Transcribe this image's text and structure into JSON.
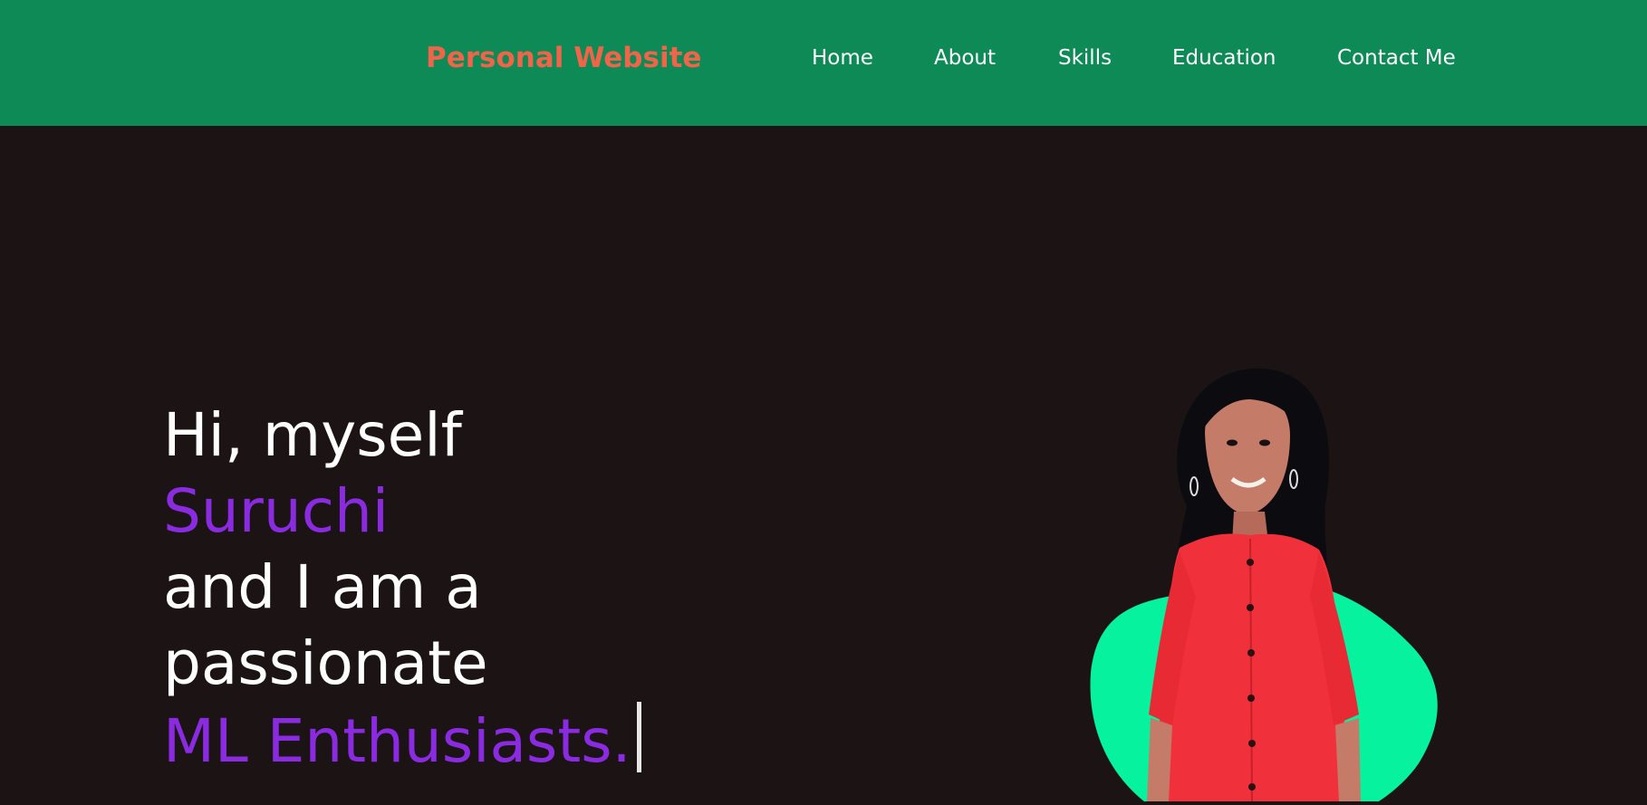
{
  "header": {
    "brand": "Personal Website",
    "nav": [
      {
        "label": "Home"
      },
      {
        "label": "About"
      },
      {
        "label": "Skills"
      },
      {
        "label": "Education"
      },
      {
        "label": "Contact Me"
      }
    ]
  },
  "hero": {
    "line1": "Hi, myself",
    "name": "Suruchi",
    "line3": "and I am a",
    "line4": "passionate",
    "role": "ML Enthusiasts."
  },
  "colors": {
    "header_bg": "#0d8a55",
    "brand": "#f0644a",
    "page_bg": "#1c1414",
    "accent_purple": "#8a2be2",
    "blob": "#06f29e",
    "shirt": "#f0313c"
  },
  "icons": {
    "cursor": "typing-cursor",
    "portrait": "profile-photo"
  }
}
